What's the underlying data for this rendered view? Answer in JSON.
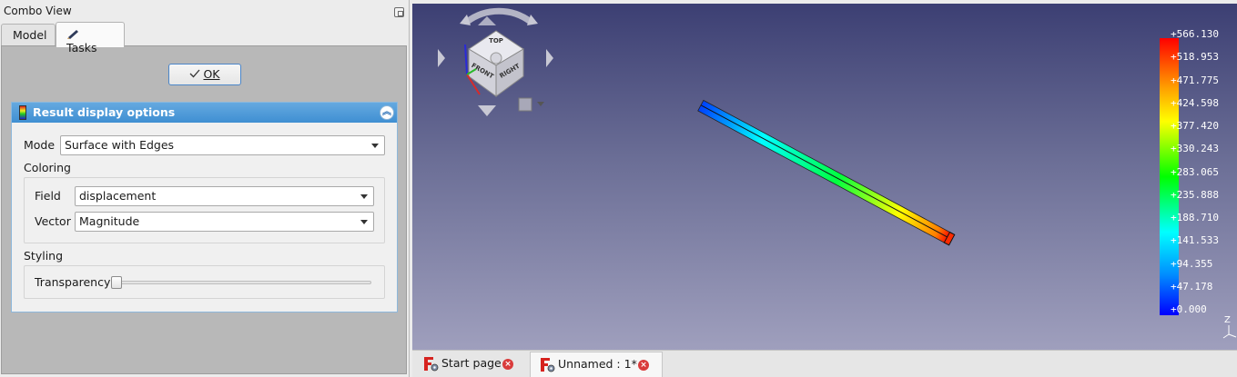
{
  "combo_view": {
    "title": "Combo View",
    "tabs": [
      {
        "label": "Model"
      },
      {
        "label": "Tasks"
      }
    ]
  },
  "task": {
    "ok_label": "OK",
    "panel_title": "Result display options",
    "mode_label": "Mode",
    "mode_value": "Surface with Edges",
    "coloring_label": "Coloring",
    "field_label": "Field",
    "field_value": "displacement",
    "vector_label": "Vector",
    "vector_value": "Magnitude",
    "styling_label": "Styling",
    "transparency_label": "Transparency",
    "transparency_value": 0
  },
  "navcube": {
    "faces": [
      "TOP",
      "FRONT",
      "RIGHT"
    ]
  },
  "color_scale": {
    "labels": [
      "+566.130",
      "+518.953",
      "+471.775",
      "+424.598",
      "+377.420",
      "+330.243",
      "+283.065",
      "+235.888",
      "+188.710",
      "+141.533",
      "+94.355",
      "+47.178",
      "+0.000"
    ]
  },
  "axis_indicator": {
    "z_label": "Z"
  },
  "doc_tabs": [
    {
      "label": "Start page"
    },
    {
      "label": "Unnamed : 1*"
    }
  ],
  "colors": {
    "panel_header": "#4a97d8",
    "viewport_top": "#3c3f73",
    "viewport_bottom": "#9f9fbd",
    "close_button": "#d93b3b"
  }
}
